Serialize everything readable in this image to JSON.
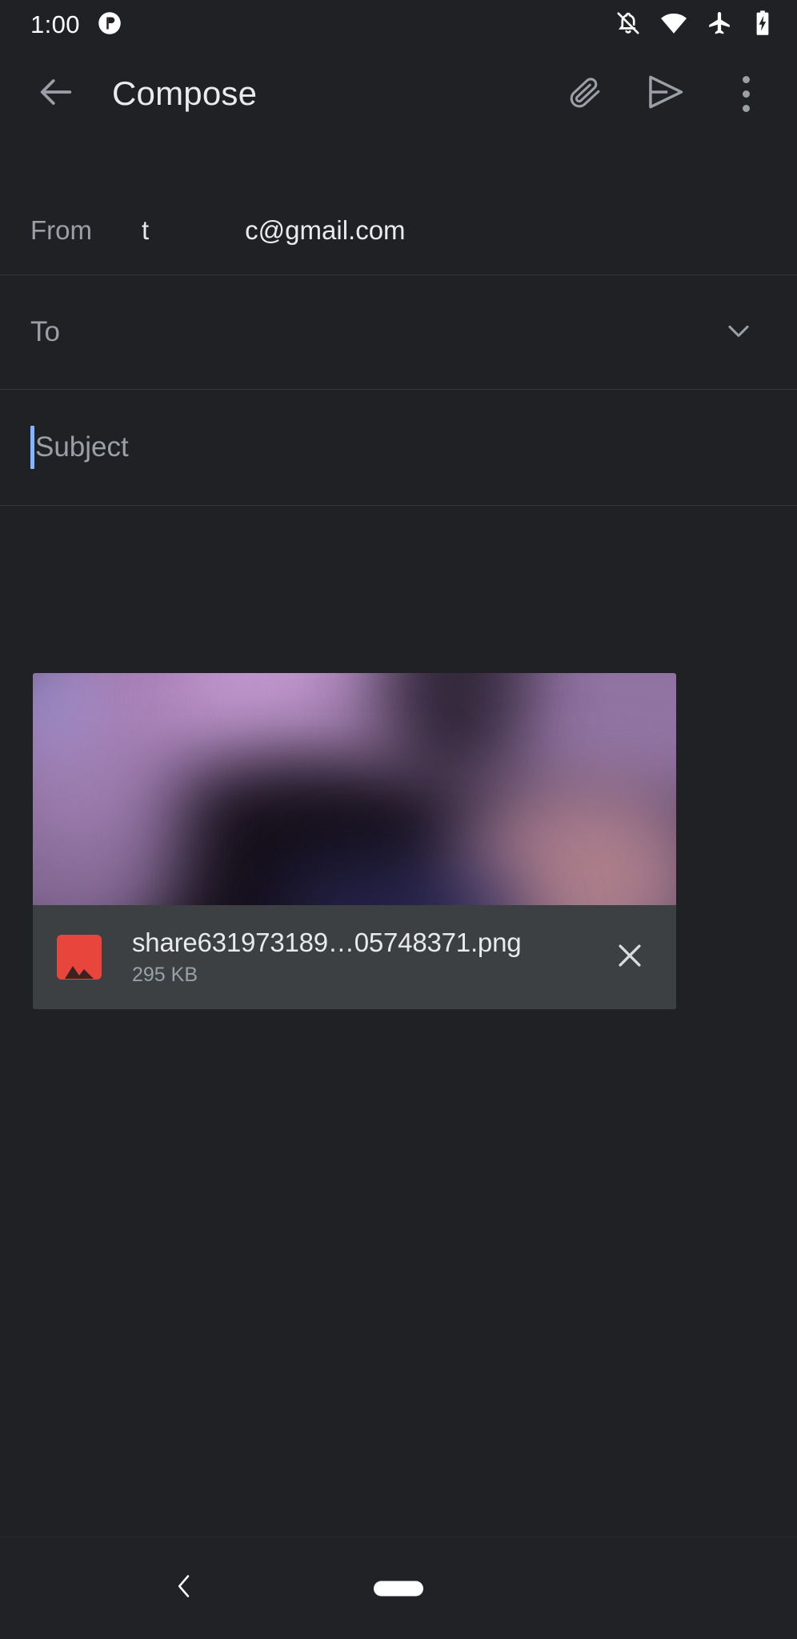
{
  "status_bar": {
    "time": "1:00",
    "notification_icon": "notification-dot-icon",
    "icons": [
      "notifications-off-icon",
      "wifi-icon",
      "airplane-mode-icon",
      "battery-charging-icon"
    ]
  },
  "app_bar": {
    "back_icon": "back-arrow-icon",
    "title": "Compose",
    "attach_icon": "paperclip-icon",
    "send_icon": "send-icon",
    "overflow_icon": "more-vert-icon"
  },
  "compose": {
    "from_label": "From",
    "from_value_prefix": "t",
    "from_value_suffix": "c@gmail.com",
    "to_placeholder": "To",
    "to_value": "",
    "expand_icon": "chevron-down-icon",
    "subject_placeholder": "Subject",
    "subject_value": "",
    "body_value": ""
  },
  "attachment": {
    "filename": "share631973189…05748371.png",
    "size": "295 KB",
    "type_icon": "image-file-icon",
    "remove_icon": "close-icon",
    "accent_color": "#e8453c",
    "card_color": "#3c4043"
  },
  "nav_bar": {
    "back_icon": "nav-back-chevron-icon",
    "home_icon": "nav-home-pill-icon"
  },
  "theme": {
    "background": "#202124",
    "text_primary": "#e8eaed",
    "text_secondary": "#9aa0a6",
    "caret": "#8ab4f8",
    "divider": "#37383b"
  }
}
